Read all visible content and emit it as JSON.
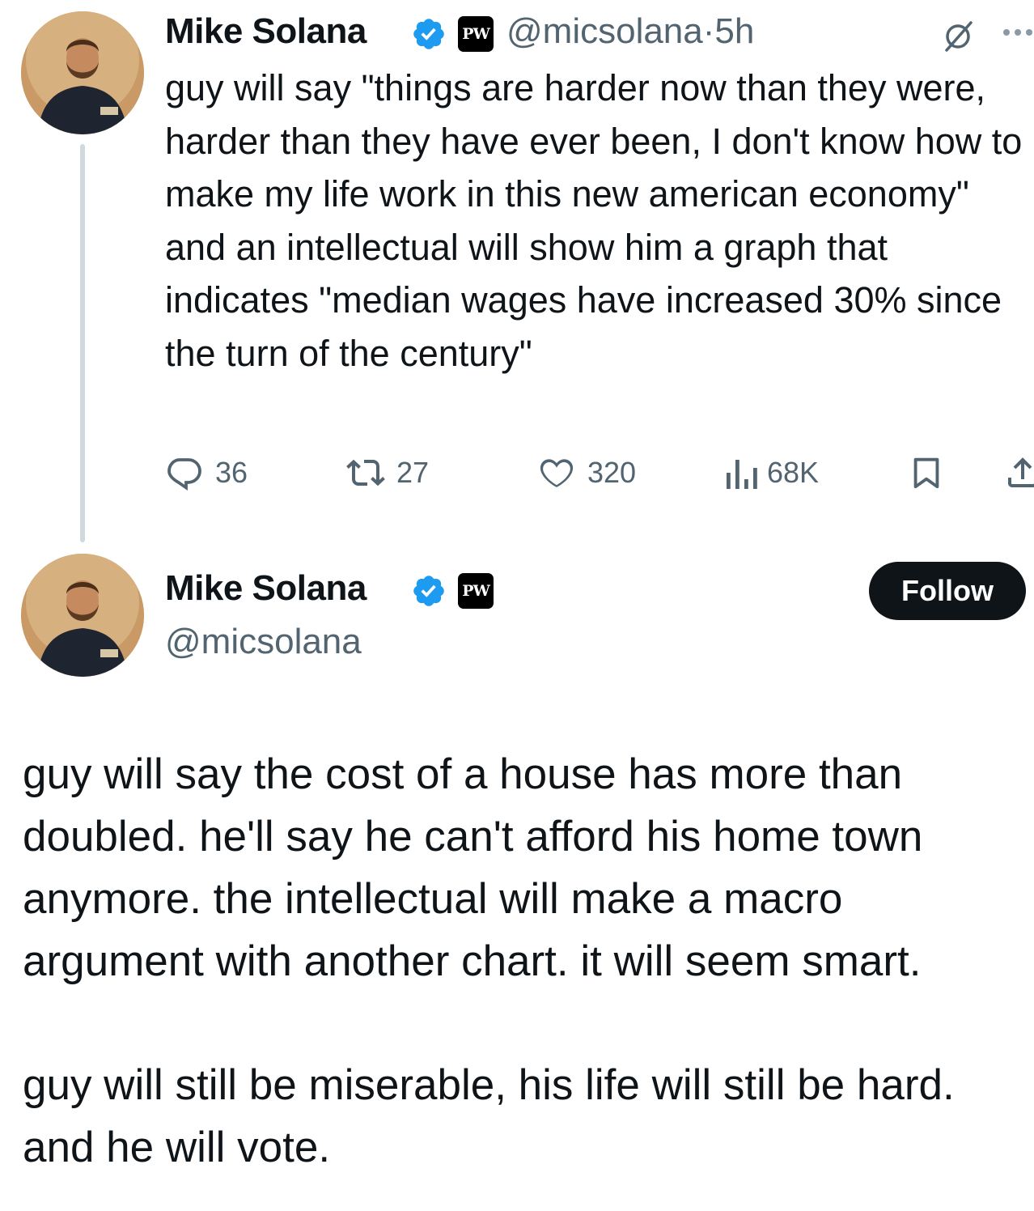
{
  "reply_tweet": {
    "author_name": "Mike Solana",
    "affiliate_badge": "PW",
    "handle": "@micsolana",
    "separator": "·",
    "time": "5h",
    "text": "guy will say \"things are harder now than they were, harder than they have ever been, I don't know how to make my life work in this new american economy\" and an intellectual will show him a graph that indicates \"median wages have increased 30% since the turn of the century\"",
    "stats": {
      "replies": "36",
      "reposts": "27",
      "likes": "320",
      "views": "68K"
    }
  },
  "main_tweet": {
    "author_name": "Mike Solana",
    "affiliate_badge": "PW",
    "handle": "@micsolana",
    "follow_label": "Follow",
    "paragraph_1": "guy will say the cost of a house has more than doubled. he'll say he can't afford his home town anymore. the intellectual will make a macro argument with another chart. it will seem smart.",
    "paragraph_2": "guy will still be miserable, his life will still be hard. and he will vote."
  },
  "colors": {
    "verified": "#1d9bf0",
    "secondary_text": "#536471",
    "thread_line": "#cfd9de"
  },
  "icons": [
    "verified-icon",
    "grok-icon",
    "more-icon",
    "reply-icon",
    "repost-icon",
    "like-icon",
    "views-icon",
    "bookmark-icon",
    "share-icon"
  ]
}
